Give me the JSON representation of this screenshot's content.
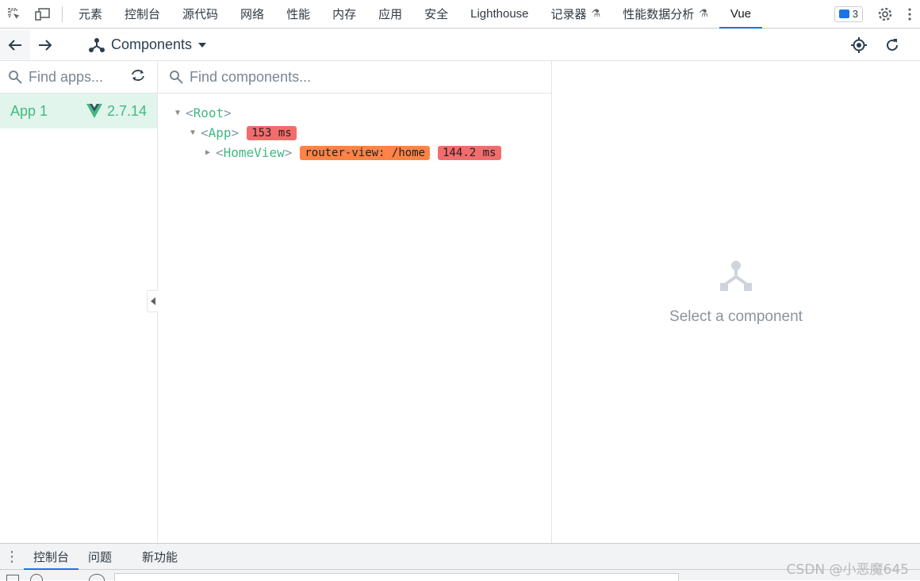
{
  "devtools": {
    "tabs": [
      "元素",
      "控制台",
      "源代码",
      "网络",
      "性能",
      "内存",
      "应用",
      "安全",
      "Lighthouse",
      "记录器",
      "性能数据分析",
      "Vue"
    ],
    "active_tab": "Vue",
    "issues_count": "3",
    "accent": "#1a73e8"
  },
  "vue": {
    "toolbar": {
      "view_label": "Components"
    },
    "apps": {
      "search_placeholder": "Find apps...",
      "items": [
        {
          "name": "App 1",
          "version": "2.7.14"
        }
      ]
    },
    "tree": {
      "search_placeholder": "Find components...",
      "root": "Root",
      "app": {
        "name": "App",
        "time": "153 ms"
      },
      "home": {
        "name": "HomeView",
        "route": "router-view: /home",
        "time": "144.2 ms"
      }
    },
    "inspector": {
      "empty_text": "Select a component"
    },
    "colors": {
      "vue_green": "#42b883",
      "time_badge": "#f36c6c",
      "route_badge": "#ff8344"
    }
  },
  "drawer": {
    "tabs": [
      "控制台",
      "问题",
      "新功能"
    ],
    "active_tab": "控制台"
  },
  "watermark": "CSDN @小恶魔645"
}
